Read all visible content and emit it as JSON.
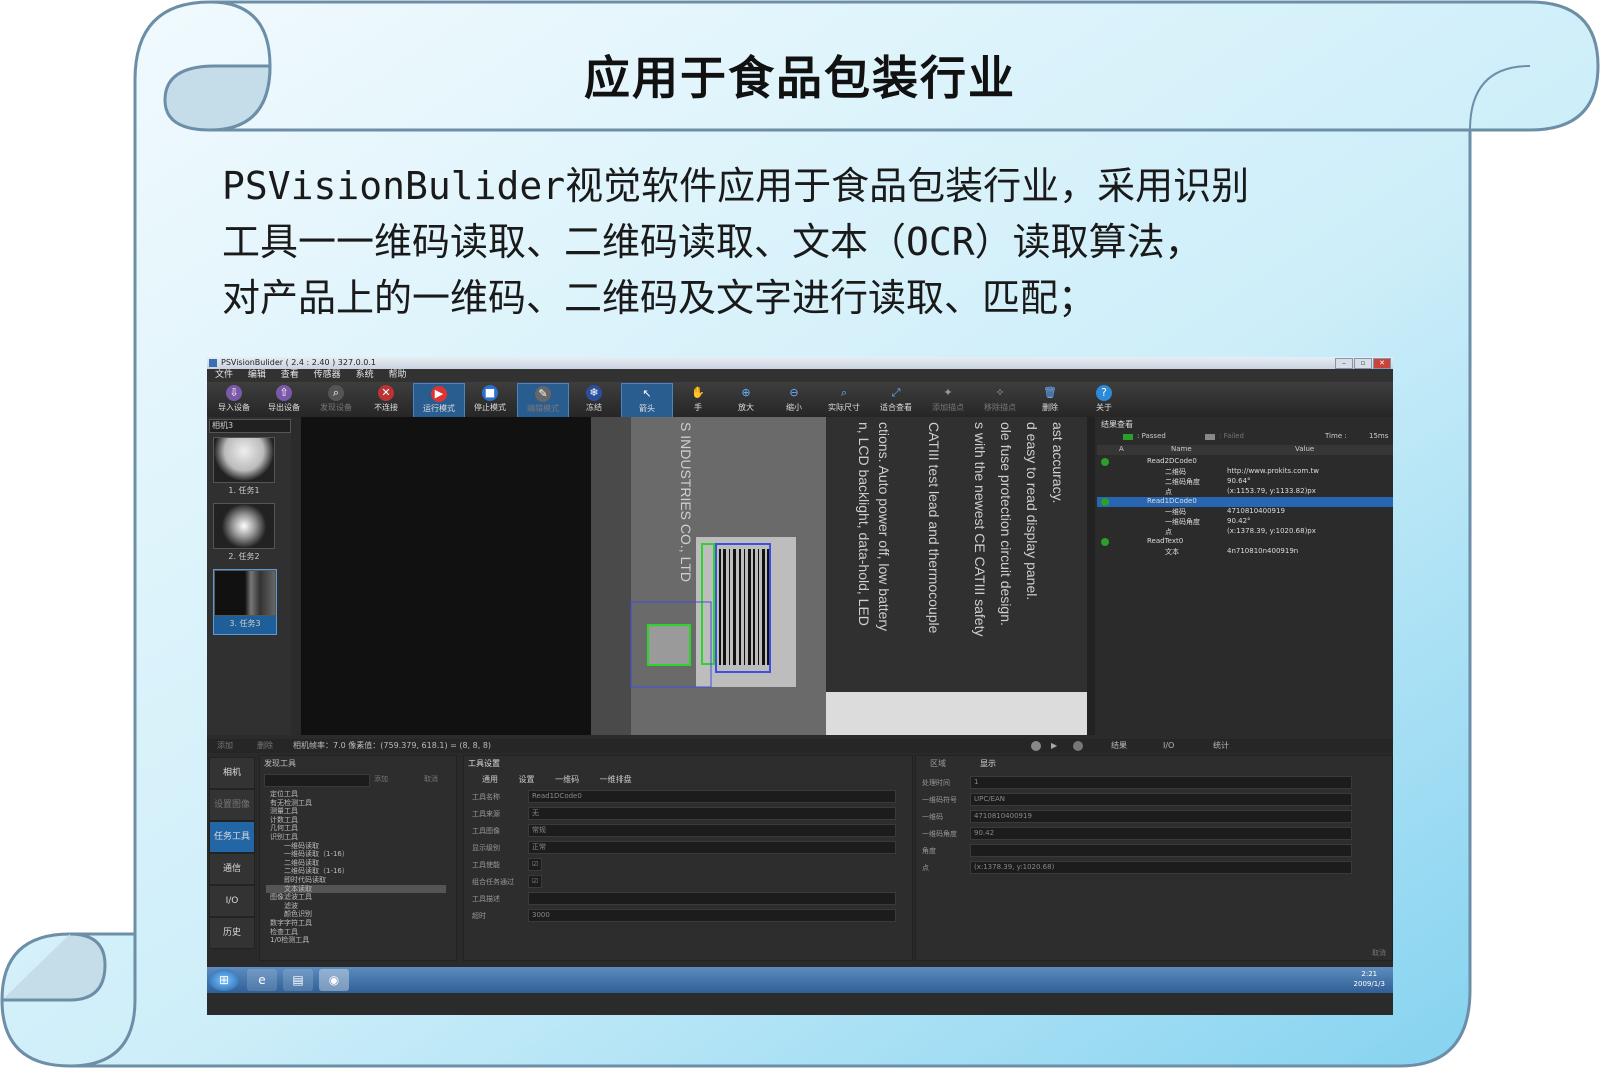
{
  "slide": {
    "title": "应用于食品包装行业",
    "body_lines": [
      "PSVisionBulider视觉软件应用于食品包装行业，采用识别",
      "工具一一维码读取、二维码读取、文本（OCR）读取算法，",
      "对产品上的一维码、二维码及文字进行读取、匹配；"
    ]
  },
  "app": {
    "title": "PSVisionBulider ( 2.4 : 2.40 ) 327.0.0.1",
    "window_buttons": [
      "–",
      "▫",
      "✕"
    ],
    "menu": [
      "文件",
      "编辑",
      "查看",
      "传感器",
      "系统",
      "帮助"
    ],
    "toolbar": [
      {
        "label": "导入设备",
        "icon": "import-icon"
      },
      {
        "label": "导出设备",
        "icon": "export-icon"
      },
      {
        "label": "发现设备",
        "icon": "discover-icon"
      },
      {
        "label": "不连接",
        "icon": "disconnect-icon"
      },
      {
        "label": "运行模式",
        "icon": "run-icon"
      },
      {
        "label": "停止模式",
        "icon": "stop-icon"
      },
      {
        "label": "编辑模式",
        "icon": "edit-icon"
      },
      {
        "label": "冻结",
        "icon": "freeze-icon"
      },
      {
        "label": "箭头",
        "icon": "pointer-icon"
      },
      {
        "label": "手",
        "icon": "hand-icon"
      },
      {
        "label": "放大",
        "icon": "zoom-in-icon"
      },
      {
        "label": "缩小",
        "icon": "zoom-out-icon"
      },
      {
        "label": "实际尺寸",
        "icon": "actual-size-icon"
      },
      {
        "label": "适合查看",
        "icon": "fit-view-icon"
      },
      {
        "label": "添加描点",
        "icon": "add-point-icon"
      },
      {
        "label": "移除描点",
        "icon": "remove-point-icon"
      },
      {
        "label": "删除",
        "icon": "delete-icon"
      },
      {
        "label": "关于",
        "icon": "about-icon"
      }
    ],
    "camera_select": "相机3",
    "tasks": [
      "1. 任务1",
      "2. 任务2",
      "3. 任务3"
    ],
    "results": {
      "header": "结果查看",
      "passed": ": Passed",
      "failed": ": Failed",
      "time_label": "Time :",
      "time_value": "15ms",
      "col_a": "A",
      "col_name": "Name",
      "col_value": "Value",
      "rows": [
        {
          "name": "Read2DCode0",
          "value": "",
          "level": 0,
          "dot": true,
          "sel": false
        },
        {
          "name": "二维码",
          "value": "http://www.prokits.com.tw",
          "level": 1,
          "dot": false,
          "sel": false
        },
        {
          "name": "二维码角度",
          "value": "90.64°",
          "level": 1,
          "dot": false,
          "sel": false
        },
        {
          "name": "点",
          "value": "(x:1153.79, y:1133.82)px",
          "level": 1,
          "dot": false,
          "sel": false
        },
        {
          "name": "Read1DCode0",
          "value": "",
          "level": 0,
          "dot": true,
          "sel": true
        },
        {
          "name": "一维码",
          "value": "4710810400919",
          "level": 1,
          "dot": false,
          "sel": false
        },
        {
          "name": "一维码角度",
          "value": "90.42°",
          "level": 1,
          "dot": false,
          "sel": false
        },
        {
          "name": "点",
          "value": "(x:1378.39, y:1020.68)px",
          "level": 1,
          "dot": false,
          "sel": false
        },
        {
          "name": "ReadText0",
          "value": "",
          "level": 0,
          "dot": true,
          "sel": false
        },
        {
          "name": "文本",
          "value": "4n710810n400919n",
          "level": 1,
          "dot": false,
          "sel": false
        }
      ]
    },
    "status": {
      "add": "添加",
      "delete": "删除",
      "info": "相机帧率：7.0  像素值：(759.379, 618.1) = (8, 8, 8)",
      "tabs": [
        "结果",
        "I/O",
        "统计"
      ]
    },
    "nav": [
      "相机",
      "设置图像",
      "任务工具",
      "通信",
      "I/O",
      "历史"
    ],
    "tools": {
      "header": "发现工具",
      "add": "添加",
      "cancel": "取消",
      "tree": [
        "定位工具",
        "有无检测工具",
        "测量工具",
        "计数工具",
        "几何工具",
        "识别工具",
        "一维码读取",
        "一维码读取（1-16）",
        "二维码读取",
        "二维码读取（1-16）",
        "即时代码读取",
        "文本读取",
        "图像滤波工具",
        "滤波",
        "颜色识别",
        "数字字符工具",
        "检查工具",
        "1/0检测工具"
      ]
    },
    "settings": {
      "header": "工具设置",
      "tabs": [
        "通用",
        "设置",
        "一维码",
        "一维排盘"
      ],
      "fields": [
        {
          "label": "工具名称",
          "value": "Read1DCode0"
        },
        {
          "label": "工具来源",
          "value": "无"
        },
        {
          "label": "工具图像",
          "value": "常规"
        },
        {
          "label": "显示级别",
          "value": "正常"
        },
        {
          "label": "工具使能",
          "value": "☑"
        },
        {
          "label": "组合任务通过",
          "value": "☑"
        },
        {
          "label": "工具描述",
          "value": ""
        },
        {
          "label": "超时",
          "value": "3000"
        }
      ]
    },
    "region": {
      "tabs": [
        "区域",
        "显示"
      ],
      "fields": [
        {
          "label": "处理时间",
          "value": "1"
        },
        {
          "label": "一维码符号",
          "value": "UPC/EAN"
        },
        {
          "label": "一维码",
          "value": "4710810400919"
        },
        {
          "label": "一维码角度",
          "value": "90.42"
        },
        {
          "label": "角度",
          "value": ""
        },
        {
          "label": "点",
          "value": "(x:1378.39, y:1020.68)"
        }
      ],
      "footer": "取消"
    },
    "taskbar": {
      "time": "2:21",
      "date": "2009/1/3"
    },
    "image_text": [
      "S INDUSTRIES CO., LTD",
      "ctions. Auto power off, low battery",
      "n, LCD backlight, data-hold, LED",
      "CATIII test lead and thermocouple",
      "s with the newest CE CATIII safety",
      "ole fuse protection circuit design.",
      "d easy to read display panel.",
      "ast accuracy."
    ]
  },
  "colors": {
    "scroll_fill": "#bfe8f7",
    "scroll_edge": "#6c8ea7",
    "toolbar_highlight": "#2a5d8f",
    "passed_green": "#2aa02a",
    "selection_blue": "#2866b1"
  }
}
